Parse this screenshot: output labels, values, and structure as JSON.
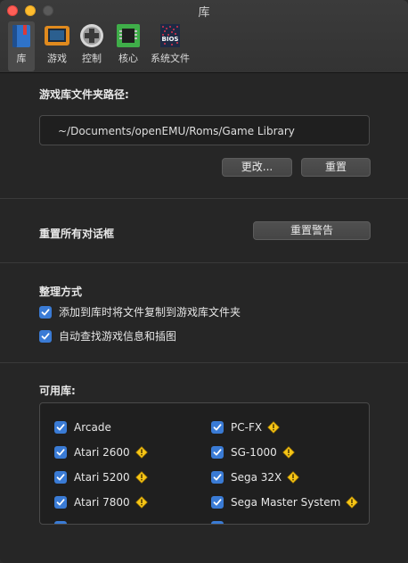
{
  "window": {
    "title": "库"
  },
  "toolbar": {
    "items": [
      {
        "label": "库",
        "icon": "library-book-icon"
      },
      {
        "label": "游戏",
        "icon": "game-monitor-icon"
      },
      {
        "label": "控制",
        "icon": "gamepad-icon"
      },
      {
        "label": "核心",
        "icon": "chip-icon"
      },
      {
        "label": "系统文件",
        "icon": "bios-icon"
      }
    ],
    "bios_text": "BIOS"
  },
  "library_path": {
    "heading": "游戏库文件夹路径:",
    "value": "~/Documents/openEMU/Roms/Game Library",
    "change_button": "更改...",
    "reset_button": "重置"
  },
  "dialogs": {
    "label": "重置所有对话框",
    "reset_warnings_button": "重置警告"
  },
  "organize": {
    "heading": "整理方式",
    "options": [
      {
        "label": "添加到库时将文件复制到游戏库文件夹",
        "checked": true
      },
      {
        "label": "自动查找游戏信息和插图",
        "checked": true
      }
    ]
  },
  "available_libraries": {
    "heading": "可用库:",
    "left": [
      {
        "name": "Arcade",
        "checked": true,
        "warning": false
      },
      {
        "name": "Atari 2600",
        "checked": true,
        "warning": true
      },
      {
        "name": "Atari 5200",
        "checked": true,
        "warning": true
      },
      {
        "name": "Atari 7800",
        "checked": true,
        "warning": true
      }
    ],
    "right": [
      {
        "name": "PC-FX",
        "checked": true,
        "warning": true
      },
      {
        "name": "SG-1000",
        "checked": true,
        "warning": true
      },
      {
        "name": "Sega 32X",
        "checked": true,
        "warning": true
      },
      {
        "name": "Sega Master System",
        "checked": true,
        "warning": true
      }
    ]
  },
  "colors": {
    "accent": "#3a7bd5",
    "warning": "#f5c518",
    "background": "#262626"
  }
}
